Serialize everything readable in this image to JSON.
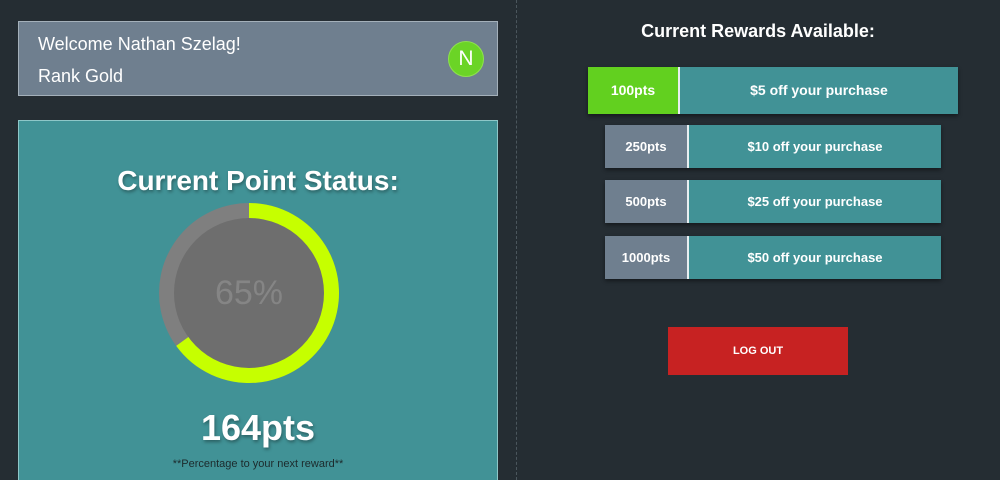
{
  "user": {
    "welcome": "Welcome Nathan Szelag!",
    "rank": "Rank Gold",
    "avatar_initial": "N"
  },
  "points_card": {
    "title": "Current Point Status:",
    "percent": 65,
    "percent_label": "65%",
    "points": "164pts",
    "note": "**Percentage to your next reward**"
  },
  "rewards": {
    "title": "Current Rewards Available:",
    "items": [
      {
        "points": "100pts",
        "description": "$5 off your purchase",
        "available": true
      },
      {
        "points": "250pts",
        "description": "$10 off your purchase",
        "available": false
      },
      {
        "points": "500pts",
        "description": "$25 off your purchase",
        "available": false
      },
      {
        "points": "1000pts",
        "description": "$50 off your purchase",
        "available": false
      }
    ]
  },
  "logout_label": "LOG OUT",
  "colors": {
    "background": "#252d33",
    "teal": "#419296",
    "slate": "#6f7f8f",
    "accent_green": "#62d01f",
    "progress_lime": "#c6ff00",
    "logout_red": "#c72222"
  }
}
